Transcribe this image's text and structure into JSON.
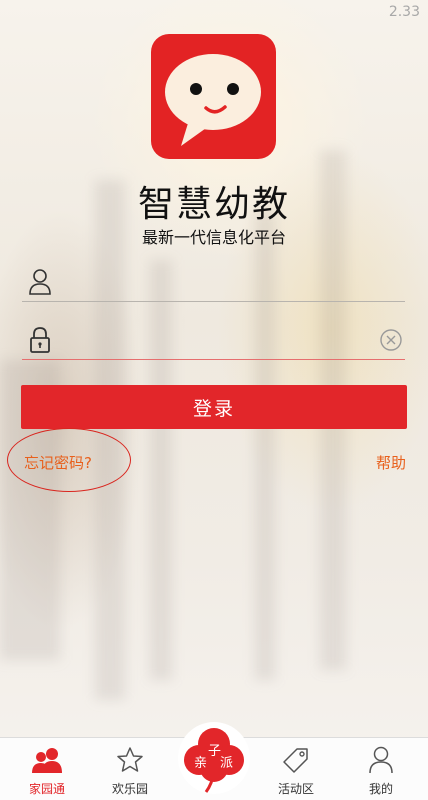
{
  "status_bar": {
    "time": "2.33"
  },
  "app": {
    "name": "智慧幼教",
    "tagline": "最新一代信息化平台"
  },
  "login": {
    "username_placeholder": "",
    "password_placeholder": "",
    "submit_label": "登录",
    "forgot_label": "忘记密码?",
    "help_label": "帮助"
  },
  "tabs": [
    {
      "label": "家园通",
      "icon": "people-icon",
      "active": true
    },
    {
      "label": "欢乐园",
      "icon": "star-icon",
      "active": false
    },
    {
      "label": "亲子派",
      "icon": "flower-badge-icon",
      "active": false
    },
    {
      "label": "活动区",
      "icon": "tag-icon",
      "active": false
    },
    {
      "label": "我的",
      "icon": "person-icon",
      "active": false
    }
  ],
  "center_badge": {
    "left": "亲",
    "top": "子",
    "right": "派"
  },
  "colors": {
    "brand_red": "#e2262a",
    "link_orange": "#e8601c",
    "annotation_red": "#d9261f"
  }
}
